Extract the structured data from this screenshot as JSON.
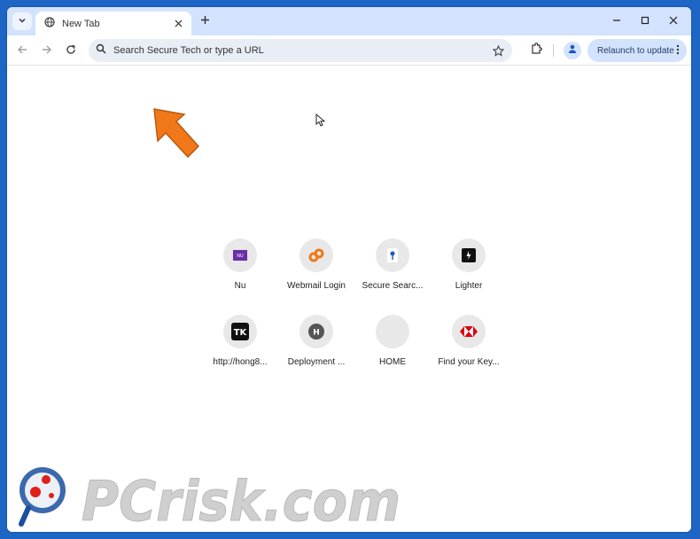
{
  "tab": {
    "title": "New Tab"
  },
  "omnibox": {
    "placeholder": "Search Secure Tech or type a URL"
  },
  "toolbar": {
    "relaunch_label": "Relaunch to update"
  },
  "shortcuts": [
    {
      "label": "Nu"
    },
    {
      "label": "Webmail Login"
    },
    {
      "label": "Secure Searc..."
    },
    {
      "label": "Lighter"
    },
    {
      "label": "http://hong8..."
    },
    {
      "label": "Deployment ..."
    },
    {
      "label": "HOME"
    },
    {
      "label": "Find your Key..."
    }
  ],
  "shortcut_icon_text": {
    "tk": "TK",
    "h": "H",
    "nu": "NU"
  },
  "watermark": {
    "text": "PCrisk.com"
  },
  "colors": {
    "accent": "#d3e3fd",
    "arrow": "#f07818",
    "desktop": "#1e66c6"
  }
}
